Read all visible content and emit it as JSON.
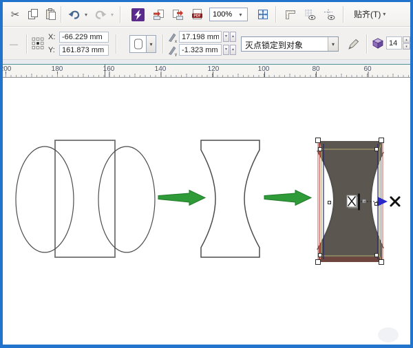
{
  "window": {
    "border_color": "#2273cc"
  },
  "toolbar": {
    "zoom_value": "100%",
    "snap_label": "贴齐(T)"
  },
  "property_bar": {
    "x_label": "X:",
    "x_value": "-66.229 mm",
    "y_label": "Y:",
    "y_value": "161.873 mm",
    "vp_x_value": "17.198 mm",
    "vp_y_value": "-1.323 mm",
    "vp_lock_value": "灭点锁定到对象",
    "depth_value": "14"
  },
  "ruler": {
    "unit": "mm",
    "labels": [
      "200",
      "180",
      "160",
      "140",
      "120",
      "100",
      "80",
      "60"
    ]
  },
  "icons": {
    "cut": "✂",
    "minus": "—",
    "caret_down": "▾",
    "spinner_up": "▴",
    "spinner_down": "▾",
    "pdf_label": "PDF"
  },
  "canvas": {
    "colors": {
      "outline": "#707070",
      "thin_outline": "#4c4c4c",
      "arrow_green": "#2f9b38",
      "arrow_green_dark": "#1e7a28",
      "solid_gray": "#5b5750",
      "bottom_face": "#6f463e",
      "frame_yellow": "#b3aa6b",
      "frame_red": "#c4574f",
      "frame_blue": "#24246e",
      "vp_arrow_blue": "#2a2ac8",
      "handle_fill": "#ffffff",
      "handle_border": "#2a2a2a"
    }
  }
}
